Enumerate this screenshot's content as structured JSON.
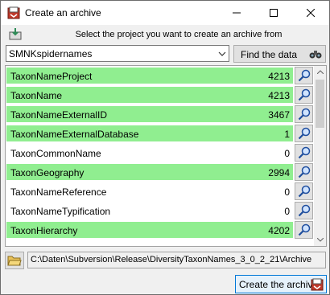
{
  "window": {
    "title": "Create an archive"
  },
  "header": {
    "instruction": "Select the project you want to create an archive from"
  },
  "project_select": {
    "value": "SMNKspidernames"
  },
  "find_button": {
    "label": "Find the data"
  },
  "tables": [
    {
      "name": "TaxonNameProject",
      "count": "4213",
      "highlighted": true
    },
    {
      "name": "TaxonName",
      "count": "4213",
      "highlighted": true
    },
    {
      "name": "TaxonNameExternalID",
      "count": "3467",
      "highlighted": true
    },
    {
      "name": "TaxonNameExternalDatabase",
      "count": "1",
      "highlighted": true
    },
    {
      "name": "TaxonCommonName",
      "count": "0",
      "highlighted": false
    },
    {
      "name": "TaxonGeography",
      "count": "2994",
      "highlighted": true
    },
    {
      "name": "TaxonNameReference",
      "count": "0",
      "highlighted": false
    },
    {
      "name": "TaxonNameTypification",
      "count": "0",
      "highlighted": false
    },
    {
      "name": "TaxonHierarchy",
      "count": "4202",
      "highlighted": true
    }
  ],
  "archive_path": {
    "value": "C:\\Daten\\Subversion\\Release\\DiversityTaxonNames_3_0_2_21\\Archive"
  },
  "create_button": {
    "label": "Create the archive"
  },
  "colors": {
    "highlight": "#90ee90",
    "accent": "#0078d7",
    "icon_red": "#c0392b"
  }
}
